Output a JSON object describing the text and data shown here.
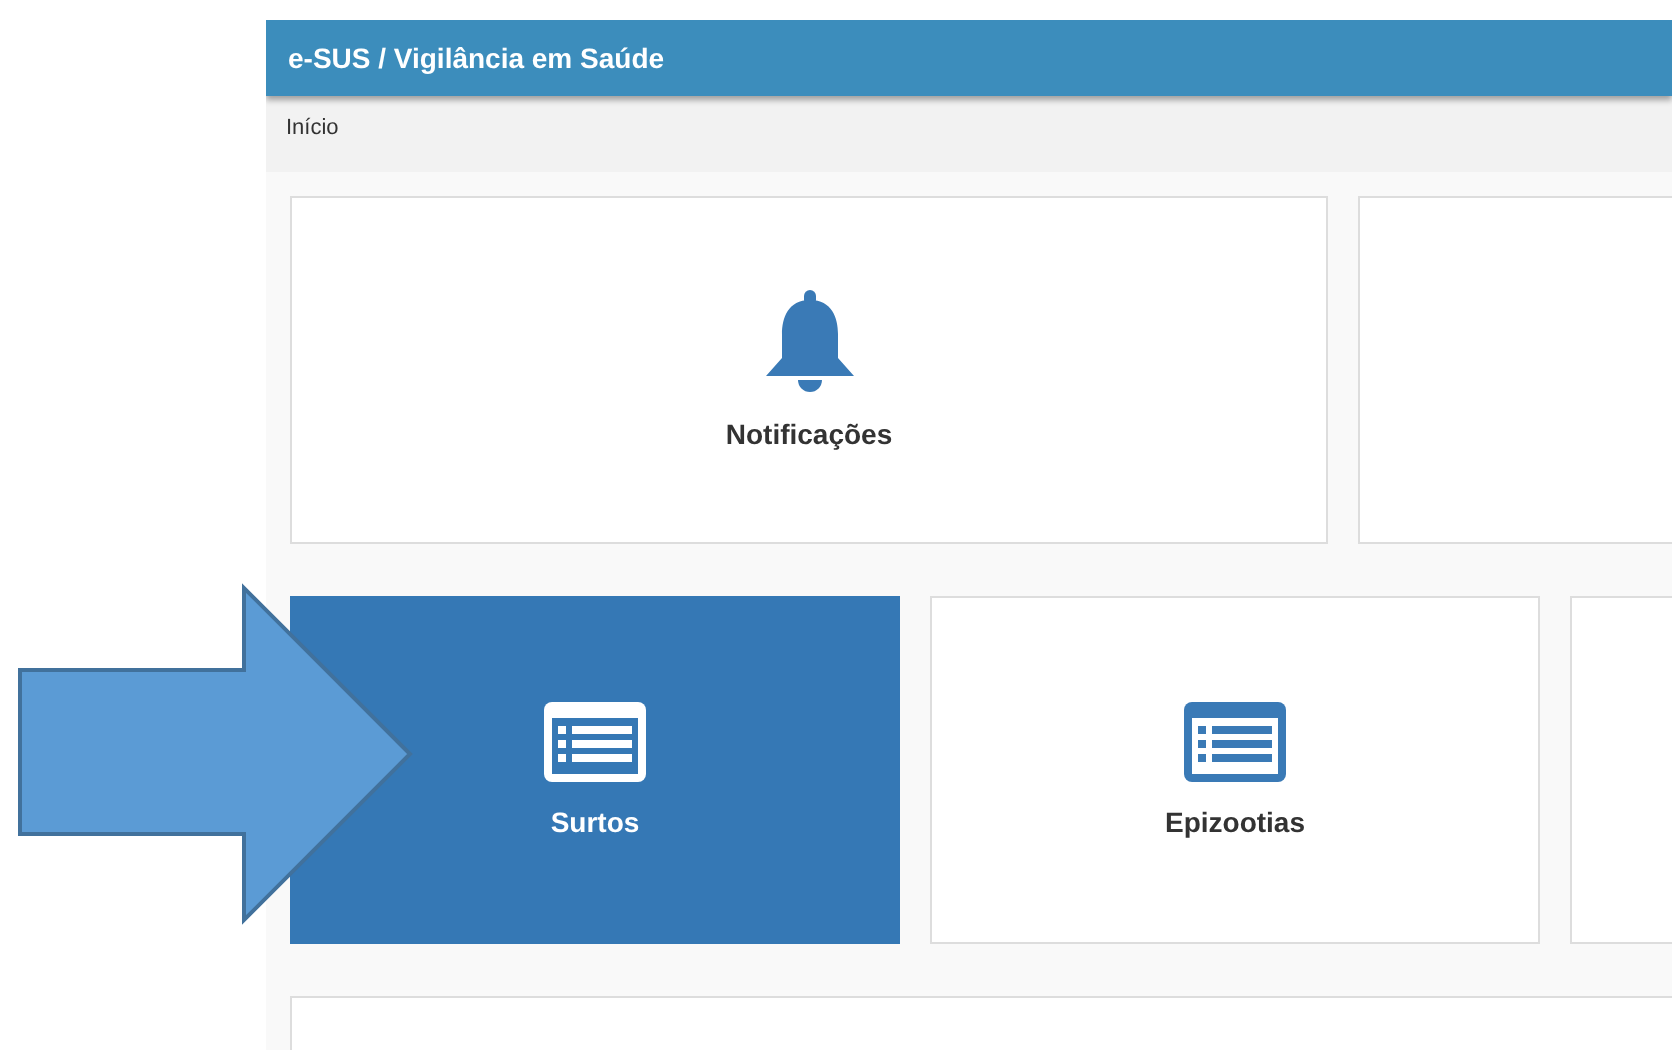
{
  "header": {
    "title": "e-SUS / Vigilância em Saúde"
  },
  "breadcrumb": {
    "label": "Início"
  },
  "tile_rows": [
    {
      "tiles": [
        {
          "kind": "bell",
          "label": "Notificações",
          "selected": false
        },
        {
          "kind": "empty",
          "selected": false
        }
      ]
    },
    {
      "tiles": [
        {
          "kind": "list",
          "label": "Surtos",
          "selected": true
        },
        {
          "kind": "list",
          "label": "Epizootias",
          "selected": false
        },
        {
          "kind": "empty",
          "selected": false
        }
      ]
    },
    {
      "tiles": [
        {
          "kind": "empty",
          "selected": false
        }
      ]
    }
  ],
  "annotation": {
    "kind": "arrow"
  }
}
